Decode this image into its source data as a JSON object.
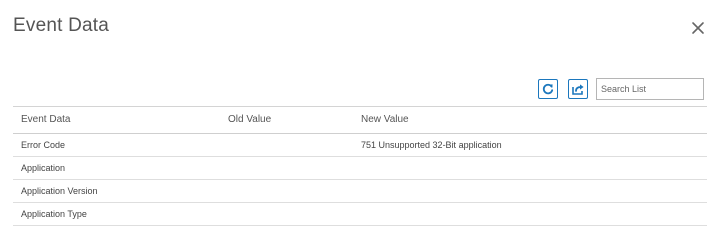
{
  "dialog": {
    "title": "Event Data",
    "close_icon": "close-icon"
  },
  "toolbar": {
    "refresh_icon": "refresh-icon",
    "export_icon": "export-icon",
    "accent_color": "#1b77bd",
    "search_placeholder": "Search List",
    "search_value": ""
  },
  "table": {
    "columns": [
      "Event Data",
      "Old Value",
      "New Value"
    ],
    "rows": [
      {
        "event_data": "Error Code",
        "old_value": "",
        "new_value": "751 Unsupported 32-Bit application"
      },
      {
        "event_data": "Application",
        "old_value": "",
        "new_value": ""
      },
      {
        "event_data": "Application Version",
        "old_value": "",
        "new_value": ""
      },
      {
        "event_data": "Application Type",
        "old_value": "",
        "new_value": ""
      }
    ]
  }
}
